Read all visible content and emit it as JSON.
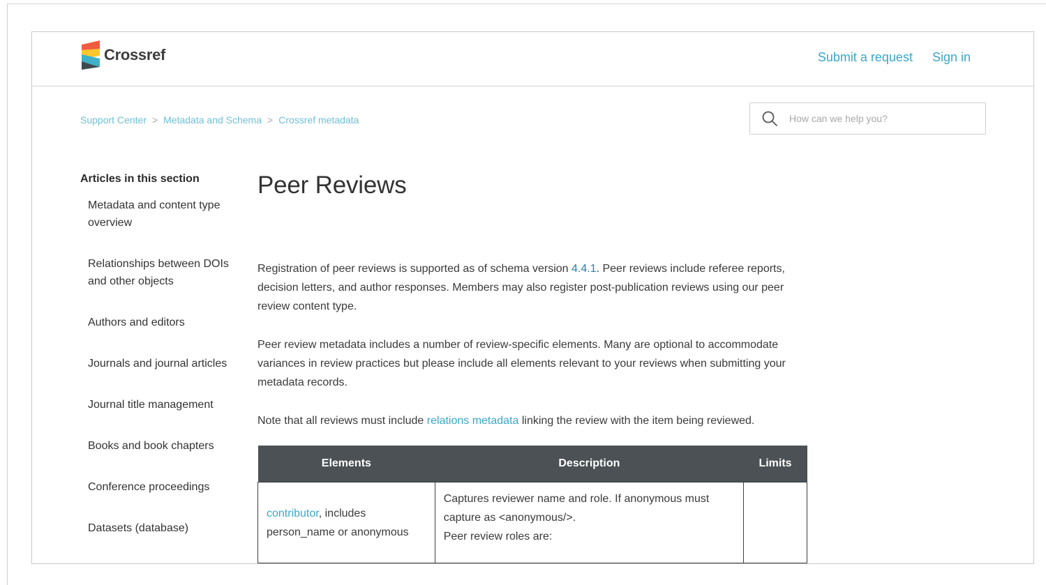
{
  "brand": {
    "name": "Crossref"
  },
  "header": {
    "submit_label": "Submit a request",
    "signin_label": "Sign in"
  },
  "breadcrumb": [
    "Support Center",
    "Metadata and Schema",
    "Crossref metadata"
  ],
  "breadcrumb_separator": ">",
  "search": {
    "placeholder": "How can we help you?",
    "icon": "search-icon"
  },
  "sidebar": {
    "title": "Articles in this section",
    "items": [
      {
        "label": "Metadata and content type overview"
      },
      {
        "label": "Relationships between DOIs and other objects"
      },
      {
        "label": "Authors and editors"
      },
      {
        "label": "Journals and journal articles"
      },
      {
        "label": "Journal title management"
      },
      {
        "label": "Books and book chapters"
      },
      {
        "label": "Conference proceedings"
      },
      {
        "label": "Datasets (database)"
      }
    ]
  },
  "article": {
    "title": "Peer Reviews",
    "p1": {
      "a": "Registration of peer reviews is supported as of schema version ",
      "link": "4.4.1",
      "b": ". Peer reviews include referee reports, decision letters, and author responses. Members may also register  post-publication reviews using our peer review content type."
    },
    "p2": "Peer review metadata includes a number of review-specific elements. Many are optional to accommodate variances in review practices but please include all elements relevant to your reviews when submitting your metadata records.",
    "p3": {
      "a": "Note that all reviews must include ",
      "link": "relations metadata",
      "b": " linking the review with the item being reviewed."
    },
    "table": {
      "headers": [
        "Elements",
        "Description",
        "Limits"
      ],
      "rows": [
        {
          "element_link": "contributor",
          "element_rest": ", includes person_name or anonymous",
          "description": [
            "Captures reviewer name and role. If anonymous must capture as <anonymous/>.",
            "Peer review roles are:"
          ],
          "limits": ""
        }
      ]
    }
  },
  "colors": {
    "link": "#3aa7c8",
    "table_header": "#4b5155"
  }
}
